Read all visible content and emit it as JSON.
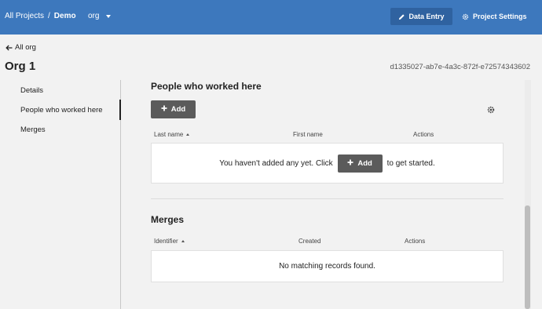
{
  "header": {
    "breadcrumb": {
      "root": "All Projects",
      "separator": "/",
      "current": "Demo"
    },
    "org_select": "org",
    "data_entry_label": "Data Entry",
    "project_settings_label": "Project Settings"
  },
  "back_link": "All org",
  "page_title": "Org 1",
  "record_id": "d1335027-ab7e-4a3c-872f-e72574343602",
  "sidebar": {
    "items": [
      {
        "label": "Details"
      },
      {
        "label": "People who worked here"
      },
      {
        "label": "Merges"
      }
    ]
  },
  "people_section": {
    "title": "People who worked here",
    "add_label": "Add",
    "columns": [
      "Last name",
      "First name",
      "Actions"
    ],
    "empty_before": "You haven't added any yet. Click",
    "empty_add_label": "Add",
    "empty_after": "to get started."
  },
  "merges_section": {
    "title": "Merges",
    "columns": [
      "Identifier",
      "Created",
      "Actions"
    ],
    "empty_message": "No matching records found."
  },
  "colors": {
    "header_bg": "#3d78bd",
    "active_button_bg": "#2f62a0",
    "add_button_bg": "#5b5b5b"
  }
}
